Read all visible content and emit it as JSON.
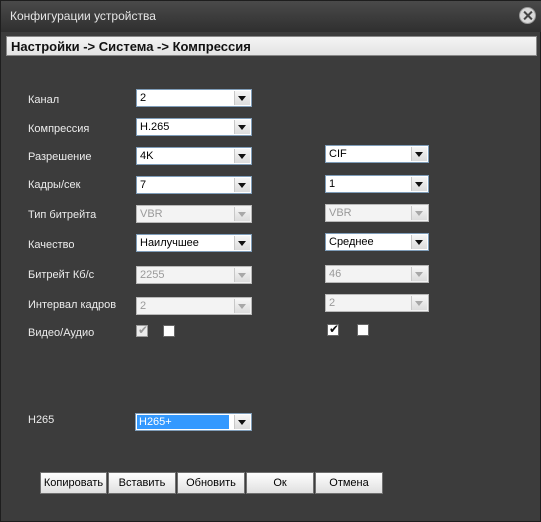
{
  "window": {
    "title": "Конфигурации устройства",
    "breadcrumb": "Настройки -> Система -> Компрессия"
  },
  "labels": {
    "channel": "Канал",
    "compression": "Компрессия",
    "resolution": "Разрешение",
    "fps": "Кадры/сек",
    "bitrate_type": "Тип битрейта",
    "quality": "Качество",
    "bitrate": "Битрейт Кб/с",
    "frame_interval": "Интервал кадров",
    "video_audio": "Видео/Аудио",
    "h265": "H265"
  },
  "main": {
    "channel": "2",
    "compression": "H.265",
    "resolution": "4K",
    "fps": "7",
    "bitrate_type": "VBR",
    "quality": "Наилучшее",
    "bitrate": "2255",
    "frame_interval": "2",
    "video_checked": true,
    "audio_checked": false,
    "h265_mode": "H265+"
  },
  "extra": {
    "resolution": "CIF",
    "fps": "1",
    "bitrate_type": "VBR",
    "quality": "Среднее",
    "bitrate": "46",
    "frame_interval": "2",
    "video_checked": true,
    "audio_checked": false
  },
  "buttons": {
    "copy": "Копировать",
    "paste": "Вставить",
    "refresh": "Обновить",
    "ok": "Ок",
    "cancel": "Отмена"
  },
  "colors": {
    "window_bg": "#3c3c3c",
    "highlight": "#3399ff"
  }
}
